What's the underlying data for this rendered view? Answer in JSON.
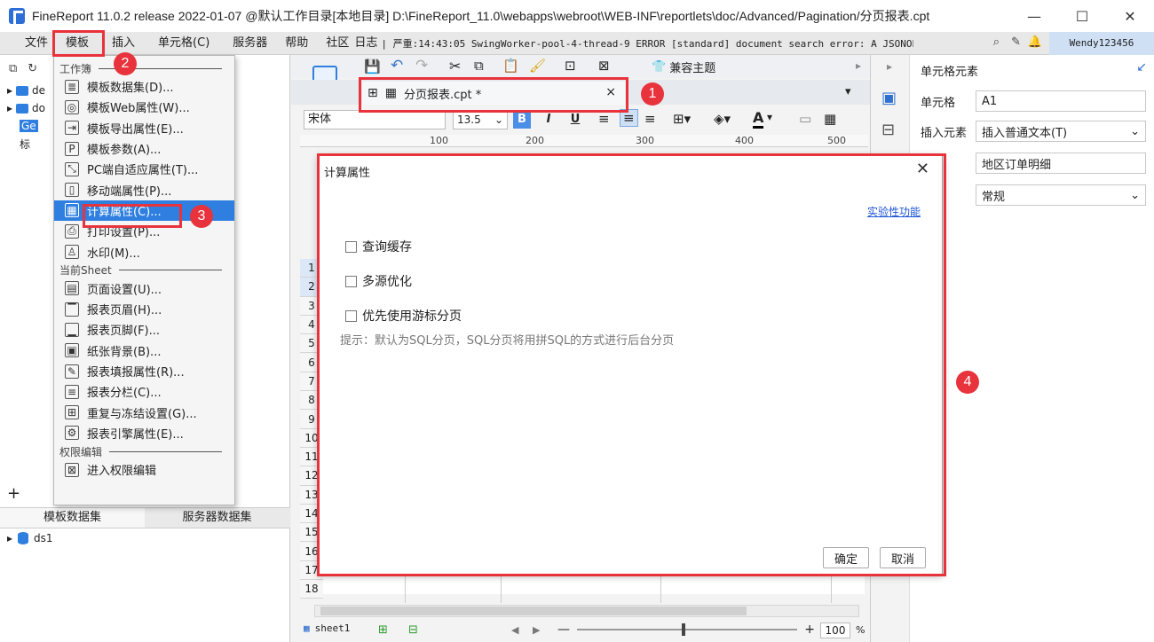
{
  "window": {
    "title": "FineReport 11.0.2 release 2022-01-07 @默认工作目录[本地目录]    D:\\FineReport_11.0\\webapps\\webroot\\WEB-INF\\reportlets\\doc/Advanced/Pagination/分页报表.cpt",
    "minimize": "—",
    "maximize": "☐",
    "close": "✕"
  },
  "menubar": {
    "items": [
      "文件",
      "模板",
      "插入",
      "单元格(C)",
      "服务器",
      "帮助",
      "社区",
      "日志"
    ],
    "log_text": "| 严重:14:43:05 SwingWorker-pool-4-thread-9 ERROR [standard] document search error: A JSONOb...",
    "user": "Wendy123456"
  },
  "left_panel": {
    "tree": [
      "de",
      "do",
      "Ge",
      "标"
    ],
    "tabs": [
      "模板数据集",
      "服务器数据集"
    ],
    "dataset": "ds1",
    "add": "+"
  },
  "dropdown": {
    "sections": [
      "工作簿",
      "当前Sheet",
      "权限编辑"
    ],
    "workbook_items": [
      {
        "label": "模板数据集(D)...",
        "icon": "≣"
      },
      {
        "label": "模板Web属性(W)...",
        "icon": "◎"
      },
      {
        "label": "模板导出属性(E)...",
        "icon": "⇥"
      },
      {
        "label": "模板参数(A)...",
        "icon": "P"
      },
      {
        "label": "PC端自适应属性(T)...",
        "icon": "⤡"
      },
      {
        "label": "移动端属性(P)...",
        "icon": "▯"
      },
      {
        "label": "计算属性(C)...",
        "icon": "▦"
      },
      {
        "label": "打印设置(P)...",
        "icon": "⎙"
      },
      {
        "label": "水印(M)...",
        "icon": "♙"
      }
    ],
    "sheet_items": [
      {
        "label": "页面设置(U)...",
        "icon": "▤"
      },
      {
        "label": "报表页眉(H)...",
        "icon": "▔"
      },
      {
        "label": "报表页脚(F)...",
        "icon": "▁"
      },
      {
        "label": "纸张背景(B)...",
        "icon": "▣"
      },
      {
        "label": "报表填报属性(R)...",
        "icon": "✎"
      },
      {
        "label": "报表分栏(C)...",
        "icon": "≡"
      },
      {
        "label": "重复与冻结设置(G)...",
        "icon": "⊞"
      },
      {
        "label": "报表引擎属性(E)...",
        "icon": "⚙"
      }
    ],
    "perm_items": [
      {
        "label": "进入权限编辑",
        "icon": "⊠"
      }
    ]
  },
  "toolbar": {
    "compat_theme": "兼容主题",
    "tab_label": "分页报表.cpt *",
    "tab_close": "×",
    "font": "宋体",
    "font_size": "13.5",
    "bold": "B",
    "italic": "I",
    "underline": "U",
    "ruler_marks": [
      "100",
      "200",
      "300",
      "400",
      "500"
    ]
  },
  "grid": {
    "rows": [
      "1",
      "2",
      "3",
      "4",
      "5",
      "6",
      "7",
      "8",
      "9",
      "10",
      "11",
      "12",
      "13",
      "14",
      "15",
      "16",
      "17",
      "18"
    ],
    "sheet_tab": "sheet1",
    "zoom": "100",
    "zoom_unit": "%"
  },
  "right_panel": {
    "title": "单元格元素",
    "cell_label": "单元格",
    "cell_value": "A1",
    "insert_label": "插入元素",
    "insert_value": "插入普通文本(T)",
    "content_value": "地区订单明细",
    "type_value": "常规"
  },
  "dialog": {
    "title": "计算属性",
    "experimental": "实验性功能",
    "options": [
      "查询缓存",
      "多源优化",
      "优先使用游标分页"
    ],
    "hint": "提示：默认为SQL分页，SQL分页将用拼SQL的方式进行后台分页",
    "ok": "确定",
    "cancel": "取消"
  },
  "annotations": [
    "1",
    "2",
    "3",
    "4"
  ]
}
